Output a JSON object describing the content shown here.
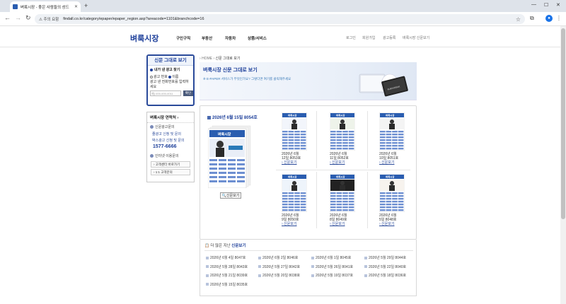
{
  "browser": {
    "tab_title": "벼룩시장 - 좋은 사람들의 성드",
    "security_label": "주의 요함",
    "url": "findall.co.kr/category/epaper/epaper_region.asp?areacode=1101&branchcode=16"
  },
  "site": {
    "logo": "벼룩시장",
    "nav": [
      "구인구직",
      "부동산",
      "자동차",
      "상품/서비스"
    ],
    "util": [
      "로그인",
      "회원가입",
      "광고등록",
      "벼룩시장 신문보기"
    ]
  },
  "left": {
    "box_title": "신문 그대로 보기",
    "my_ad": "내가 낸 광고 찾기",
    "radio_ad": "광고 번호",
    "radio_name": "이름",
    "instruction": "광고 낸 전화번호를 입력하세요",
    "phone_placeholder": "예) 000-000-0011",
    "ok_label": "확인",
    "contact_title": "벼룩시장 연락처",
    "item1_title": "신문광고문의",
    "item1_link1": "줄광고 신청 및 문의",
    "item1_link2": "박스광고 신청 및 문의",
    "phone": "1577-6666",
    "item2_title": "인터넷 이용문의",
    "btn_center": "고객센터 바로가기",
    "btn_qna": "1:1 고객문의"
  },
  "main": {
    "breadcrumb_home": "HOME",
    "breadcrumb_current": "신문 그대로 보기",
    "banner_title": "벼룩시장 신문 그대로 보기",
    "banner_sub": "※ E-PAPER 서비스가 무엇인가요? 그렇다면 여기를 클릭해주세요",
    "current_issue": "2026년 6월 15일 8054호",
    "view_button": "신문보기",
    "thumb_masthead": "벼룩시장",
    "issues": [
      {
        "line1": "2026년 6월",
        "line2": "12일 8053호",
        "link": "신문보기"
      },
      {
        "line1": "2026년 6월",
        "line2": "11일 8052호",
        "link": "신문보기"
      },
      {
        "line1": "2026년 6월",
        "line2": "10일 8051호",
        "link": "신문보기"
      },
      {
        "line1": "2026년 6월",
        "line2": "9일 8050호",
        "link": "신문보기"
      },
      {
        "line1": "2026년 6월",
        "line2": "8일 8049호",
        "link": "신문보기"
      },
      {
        "line1": "2026년 6월",
        "line2": "5일 8048호",
        "link": "신문보기"
      }
    ],
    "archive_title_plain": "더 많은 지난",
    "archive_title_link": "신문보기",
    "archive": [
      "2026년 6월 4일 8047호",
      "2026년 6월 2일 8046호",
      "2026년 6월 1일 8045호",
      "2026년 5월 29일 8044호",
      "2026년 5월 28일 8043호",
      "2026년 5월 27일 8042호",
      "2026년 5월 26일 8041호",
      "2026년 5월 22일 8040호",
      "2026년 5월 21일 8039호",
      "2026년 5월 20일 8038호",
      "2026년 5월 19일 8037호",
      "2026년 5월 18일 8036호",
      "2026년 5월 15일 8035호"
    ]
  }
}
